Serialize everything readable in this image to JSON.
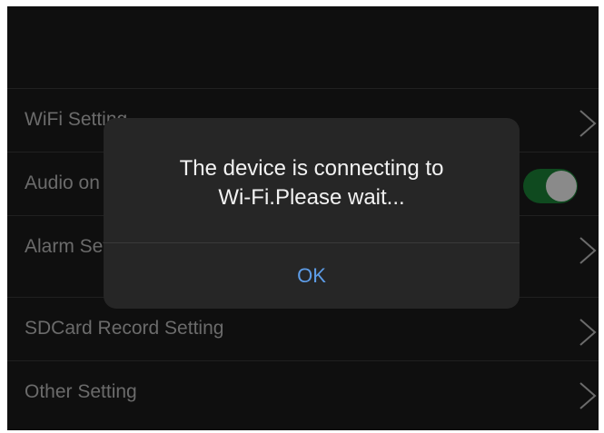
{
  "settings": {
    "items": [
      {
        "label": "WiFi Setting",
        "control": "chevron-right-icon"
      },
      {
        "label": "Audio on",
        "control": "toggle",
        "toggle_on": true
      },
      {
        "label": "Alarm Setting",
        "control": "chevron-right-icon"
      },
      {
        "label": "SDCard Record Setting",
        "control": "chevron-right-icon"
      },
      {
        "label": "Other Setting",
        "control": "chevron-right-icon"
      }
    ]
  },
  "dialog": {
    "message_line1": "The device is connecting to",
    "message_line2": "Wi-Fi.Please wait...",
    "ok_label": "OK"
  },
  "colors": {
    "background": "#0f0f0f",
    "dialog": "#262626",
    "accent": "#5d9ce6",
    "toggle_track": "#0f4a1f"
  }
}
